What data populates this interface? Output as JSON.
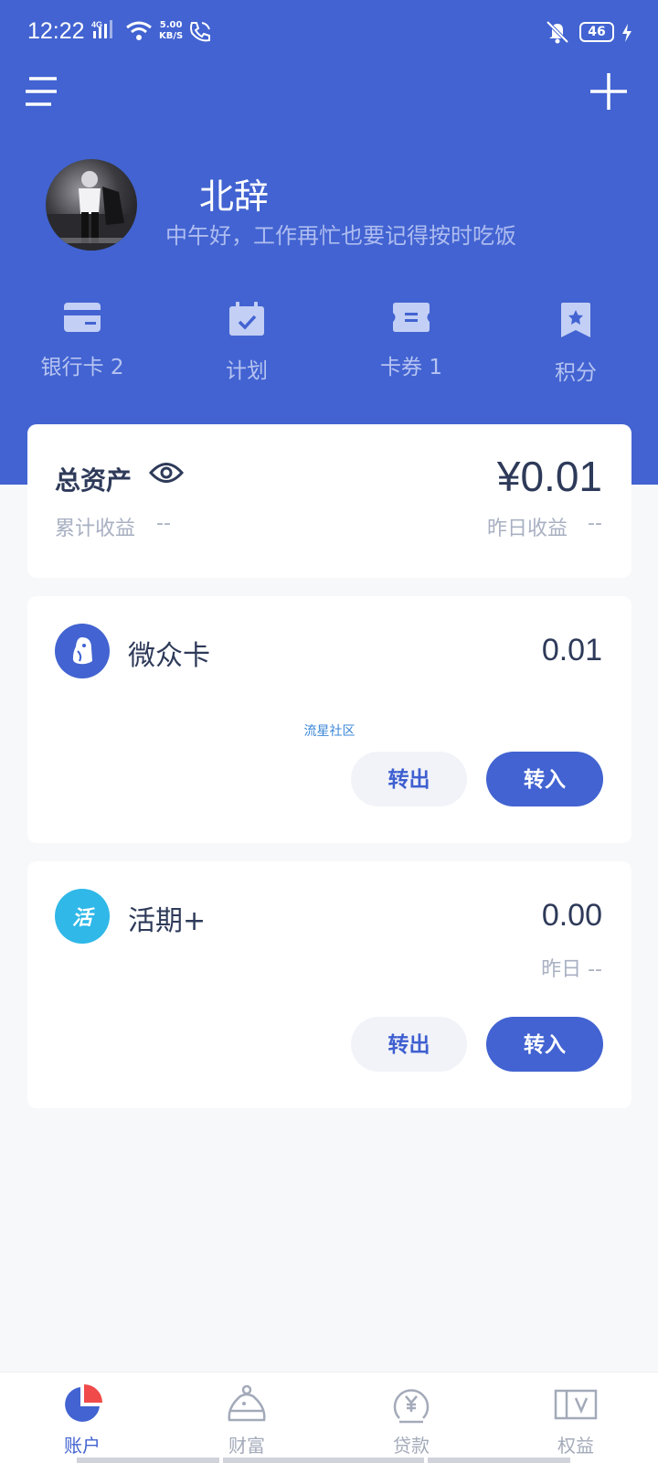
{
  "status_bar": {
    "time": "12:22",
    "network": "4G",
    "speed_value": "5.00",
    "speed_unit": "KB/S",
    "battery": "46"
  },
  "profile": {
    "name": "北辞",
    "greeting": "中午好，工作再忙也要记得按时吃饭"
  },
  "quick_menu": [
    {
      "label": "银行卡 2",
      "icon": "bank-card-icon"
    },
    {
      "label": "计划",
      "icon": "calendar-check-icon"
    },
    {
      "label": "卡券 1",
      "icon": "coupon-icon"
    },
    {
      "label": "积分",
      "icon": "bookmark-star-icon"
    }
  ],
  "assets": {
    "title": "总资产",
    "total": "¥0.01",
    "cumulative_label": "累计收益",
    "cumulative_value": "--",
    "yesterday_label": "昨日收益",
    "yesterday_value": "--"
  },
  "accounts": [
    {
      "name": "微众卡",
      "balance": "0.01",
      "icon": "penguin-icon",
      "out_label": "转出",
      "in_label": "转入",
      "watermark": "流星社区"
    },
    {
      "name": "活期+",
      "balance": "0.00",
      "icon_text": "活",
      "yesterday": "昨日 --",
      "out_label": "转出",
      "in_label": "转入"
    }
  ],
  "bottom_nav": [
    {
      "label": "账户",
      "icon": "pie-chart-icon",
      "active": true
    },
    {
      "label": "财富",
      "icon": "money-bag-icon",
      "active": false
    },
    {
      "label": "贷款",
      "icon": "yuan-coin-icon",
      "active": false
    },
    {
      "label": "权益",
      "icon": "v-ticket-icon",
      "active": false
    }
  ],
  "colors": {
    "primary": "#4263d1",
    "background": "#f7f8fa",
    "text": "#2e3a59",
    "muted": "#a8b0c2",
    "live_icon": "#2fb8e8",
    "accent_red": "#f04a4a"
  }
}
